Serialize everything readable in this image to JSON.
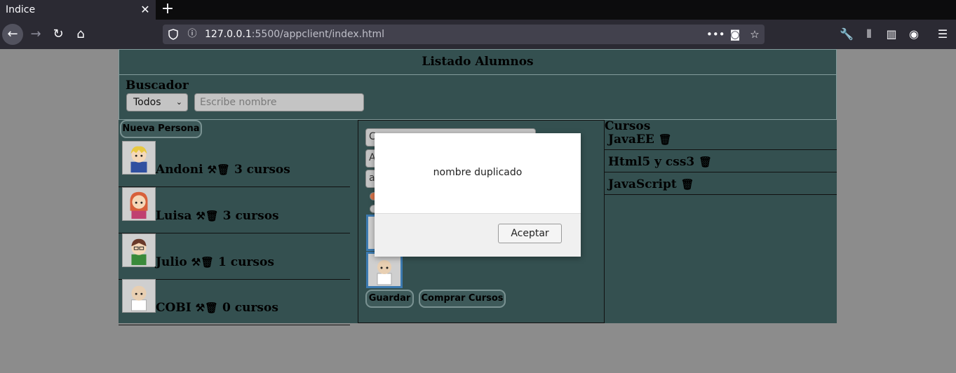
{
  "browser": {
    "tab_title": "Indice",
    "tab_close": "✕",
    "new_tab": "+",
    "url_host": "127.0.0.1",
    "url_rest": ":5500/appclient/index.html",
    "icons": {
      "back": "←",
      "forward": "→",
      "reload": "↻",
      "home": "⌂",
      "info": "ⓘ",
      "more": "•••",
      "pocket": "◙",
      "bookmark": "☆",
      "tools": "🔧",
      "library": "⫴",
      "sidebar": "▥",
      "account": "◉",
      "menu": "☰"
    }
  },
  "app": {
    "title": "Listado Alumnos",
    "search": {
      "heading": "Buscador",
      "filter_selected": "Todos",
      "filter_caret": "⌄",
      "placeholder": "Escribe nombre"
    },
    "new_person_label": "Nueva Persona",
    "icon_edit": "⚒",
    "icon_trash": "🗑",
    "people": [
      {
        "name": "Andoni",
        "courses": "3 cursos",
        "hair": "#e8c840",
        "shirt": "#3050a0"
      },
      {
        "name": "Luisa",
        "courses": "3 cursos",
        "hair": "#d8603a",
        "shirt": "#c04070"
      },
      {
        "name": "Julio",
        "courses": "1 cursos",
        "hair": "#6a3a2a",
        "shirt": "#3a8a3a"
      },
      {
        "name": "COBI",
        "courses": "0 cursos",
        "hair": "#e0c0a0",
        "shirt": "#ffffff"
      }
    ],
    "form": {
      "field1_start": "C",
      "field2_start": "A",
      "field3_start": "a",
      "save_label": "Guardar",
      "buy_label": "Comprar Cursos"
    },
    "courses_heading": "Cursos",
    "courses": [
      "JavaEE",
      "Html5 y css3",
      "JavaScript"
    ]
  },
  "dialog": {
    "message": "nombre duplicado",
    "ok_label": "Aceptar"
  }
}
